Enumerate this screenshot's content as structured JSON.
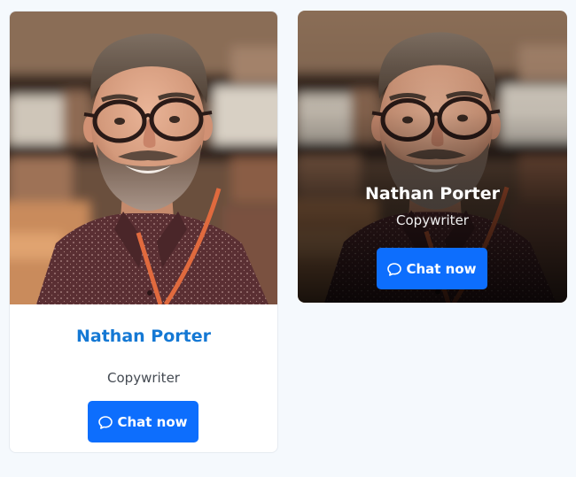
{
  "cards": [
    {
      "name": "Nathan Porter",
      "role": "Copywriter",
      "button_label": "Chat now",
      "button_icon": "chat-bubble-icon"
    },
    {
      "name": "Nathan Porter",
      "role": "Copywriter",
      "button_label": "Chat now",
      "button_icon": "chat-bubble-icon"
    }
  ],
  "colors": {
    "page_background": "#f5f9fd",
    "accent_blue": "#0d6efd",
    "name_blue": "#1478d4"
  }
}
